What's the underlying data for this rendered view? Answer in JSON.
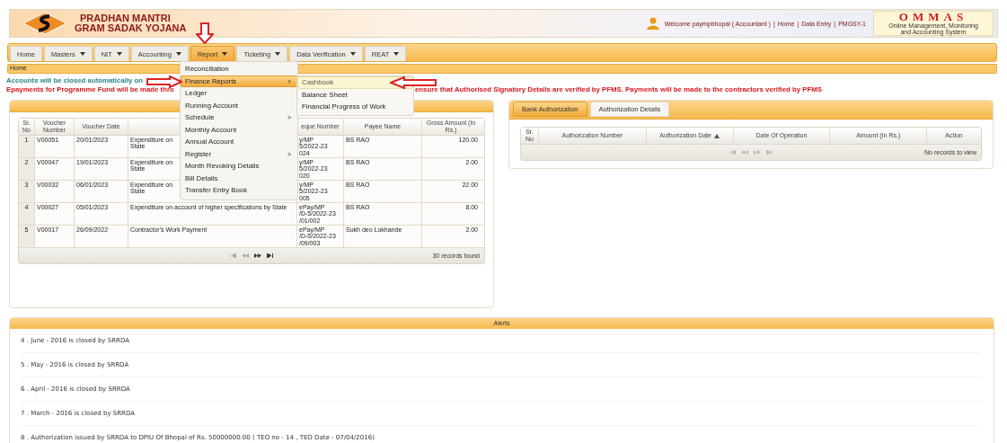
{
  "header": {
    "title_line1": "PRADHAN MANTRI",
    "title_line2": "GRAM SADAK YOJANA",
    "welcome": "Welcome paympbhopal ( Accountant )",
    "separator": "|",
    "links": [
      "Home",
      "Data Entry",
      "PMGSY-1"
    ],
    "logo_name": "OMMAS",
    "logo_subtitle": [
      "Online Management, Monitoring",
      "and Accounting System"
    ]
  },
  "nav": [
    {
      "label": "Home",
      "dropdown": false,
      "selected": false
    },
    {
      "label": "Masters",
      "dropdown": true,
      "selected": false
    },
    {
      "label": "NIT",
      "dropdown": true,
      "selected": false
    },
    {
      "label": "Accounting",
      "dropdown": true,
      "selected": false
    },
    {
      "label": "Report",
      "dropdown": true,
      "selected": true
    },
    {
      "label": "Ticketing",
      "dropdown": true,
      "selected": false
    },
    {
      "label": "Data Verification",
      "dropdown": true,
      "selected": false
    },
    {
      "label": "REAT",
      "dropdown": true,
      "selected": false
    }
  ],
  "breadcrumb": "Home",
  "notices": [
    {
      "kind": "info",
      "segments": [
        "Accounts will be closed automatically on"
      ]
    },
    {
      "kind": "warning",
      "segments": [
        "Epayments for Programme Fund will be made thro",
        "ensure that Authorised Signatory Details are verified by PFMS. Payments will be made to the contractors verified by PFMS"
      ]
    }
  ],
  "report_menu": [
    {
      "label": "Reconciliation",
      "submenu": false,
      "selected": false
    },
    {
      "label": "Finance Reports",
      "submenu": true,
      "selected": true
    },
    {
      "label": "Ledger",
      "submenu": false,
      "selected": false
    },
    {
      "label": "Running Account",
      "submenu": false,
      "selected": false
    },
    {
      "label": "Schedule",
      "submenu": true,
      "selected": false
    },
    {
      "label": "Monthly Account",
      "submenu": false,
      "selected": false
    },
    {
      "label": "Annual Account",
      "submenu": false,
      "selected": false
    },
    {
      "label": "Register",
      "submenu": true,
      "selected": false
    },
    {
      "label": "Month Revoking Details",
      "submenu": false,
      "selected": false
    },
    {
      "label": "Bill Details",
      "submenu": false,
      "selected": false
    },
    {
      "label": "Transfer Entry Book",
      "submenu": false,
      "selected": false
    }
  ],
  "submenu_arrow": ">",
  "finance_submenu": [
    {
      "label": "Cashbook",
      "selected": true
    },
    {
      "label": "Balance Sheet",
      "selected": false
    },
    {
      "label": "Financial Progress of Work",
      "selected": false
    }
  ],
  "voucher_table": {
    "columns": [
      "Sr. No",
      "Voucher Number",
      "Voucher Date",
      "",
      "eque Number",
      "Payee Name",
      "Gross Amount (In Rs.)"
    ],
    "rows": [
      [
        "1",
        "V00051",
        "20/01/2023",
        "Expenditure on\nState",
        "y/MP\n5/2022-23\n024",
        "BS RAO",
        "120.00"
      ],
      [
        "2",
        "V00047",
        "19/01/2023",
        "Expenditure on\nState",
        "y/MP\n5/2022-23\n020",
        "BS RAO",
        "2.00"
      ],
      [
        "3",
        "V00032",
        "06/01/2023",
        "Expenditure on\nState",
        "y/MP\n5/2022-23\n005",
        "BS RAO",
        "22.00"
      ],
      [
        "4",
        "V00027",
        "05/01/2023",
        "Expenditure on account of higher specifications by State",
        "ePay/MP\n/D-5/2022-23\n/01/002",
        "BS RAO",
        "8.00"
      ],
      [
        "5",
        "V00017",
        "26/09/2022",
        "Contractor's Work Payment",
        "ePay/MP\n/D-5/2022-23\n/09/003",
        "Sukh deo Lokhande",
        "2.00"
      ]
    ],
    "records": "30 records found"
  },
  "auth_panel": {
    "tabs": [
      {
        "label": "Bank Authorization",
        "selected": true
      },
      {
        "label": "Authorization Details",
        "selected": false
      }
    ],
    "columns": [
      {
        "label": "Sr. No",
        "sorted": false
      },
      {
        "label": "Authorization Number",
        "sorted": false
      },
      {
        "label": "Authorization Date",
        "sorted": true
      },
      {
        "label": "Date Of Operation",
        "sorted": false
      },
      {
        "label": "Amount (In Rs.)",
        "sorted": false
      },
      {
        "label": "Action",
        "sorted": false
      }
    ],
    "records": "No records to view"
  },
  "alerts": {
    "title": "Alerts",
    "items": [
      "4 . June - 2016 is closed by SRRDA",
      "5 . May - 2016 is closed by SRRDA",
      "6 . April - 2016 is closed by SRRDA",
      "7 . March - 2016 is closed by SRRDA",
      "8 . Authorization issued by SRRDA to DPIU Of Bhopal of Rs. 50000000.00 ( TEO no - 14 , TEO Date - 07/04/2016)"
    ]
  }
}
